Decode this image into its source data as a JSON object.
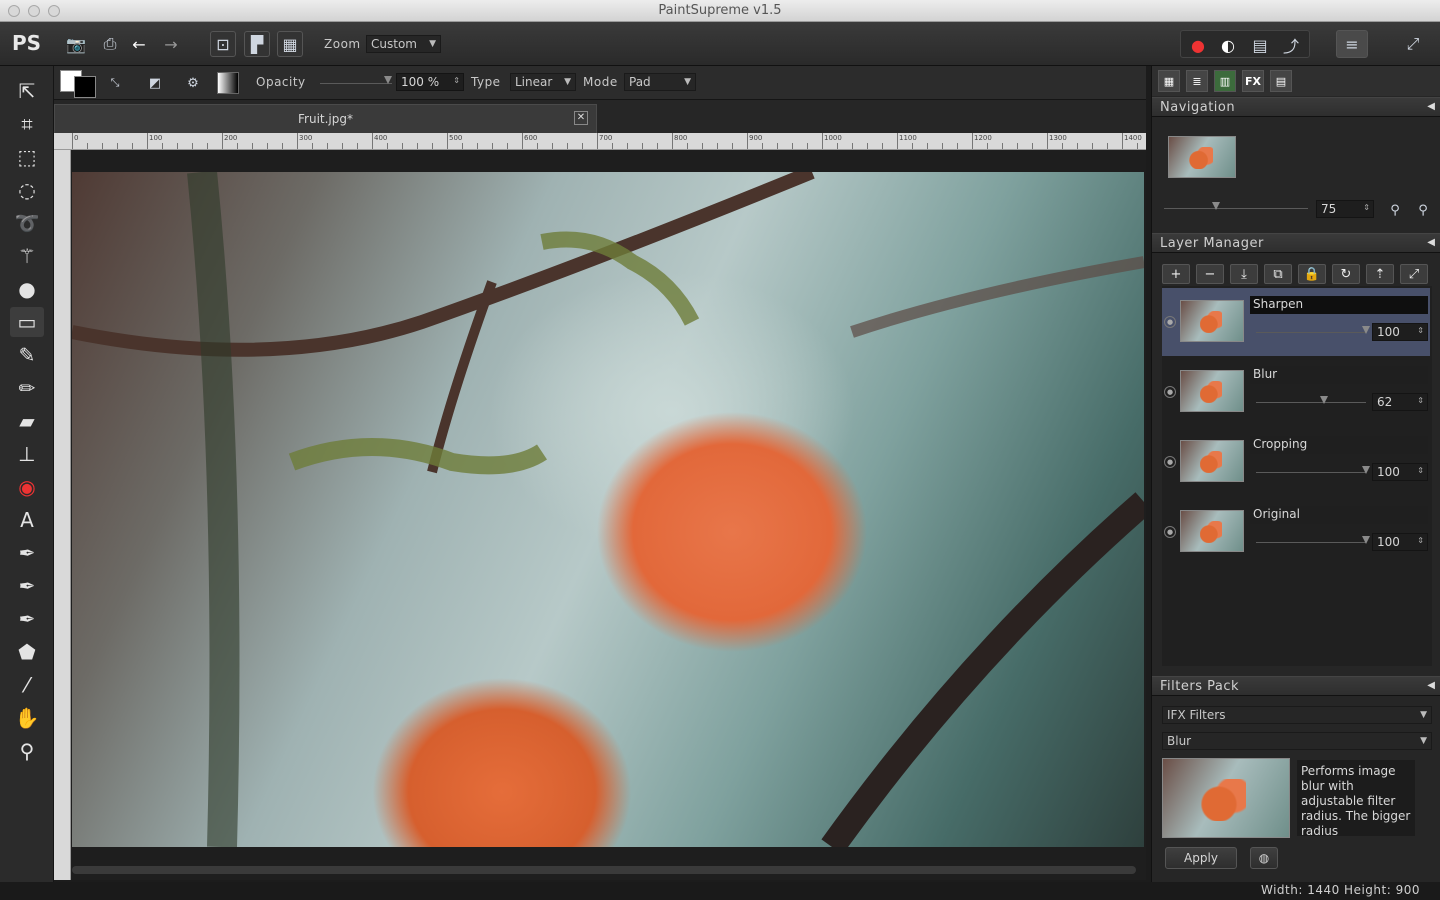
{
  "window": {
    "title": "PaintSupreme v1.5"
  },
  "toolbar": {
    "logo": "PS",
    "zoom_label": "Zoom",
    "zoom_value": "Custom",
    "icons": [
      "open-icon",
      "save-icon",
      "undo-icon",
      "redo-icon",
      "fit-icon",
      "frame-icon",
      "grid-icon"
    ],
    "right_icons": [
      "color-wheel-icon",
      "contrast-icon",
      "levels-icon",
      "curves-icon",
      "layers-icon",
      "fullscreen-icon"
    ]
  },
  "options": {
    "opacity_label": "Opacity",
    "opacity_value": "100 %",
    "type_label": "Type",
    "type_value": "Linear",
    "mode_label": "Mode",
    "mode_value": "Pad"
  },
  "tools": [
    "select-icon",
    "crop-icon",
    "rect-select-icon",
    "ellipse-select-icon",
    "lasso-icon",
    "magic-wand-icon",
    "blur-icon",
    "gradient-icon",
    "brush-icon",
    "pencil-icon",
    "eraser-icon",
    "stamp-icon",
    "red-eye-icon",
    "text-icon",
    "pen-icon",
    "pen-add-icon",
    "pen-remove-icon",
    "shape-icon",
    "eyedropper-icon",
    "hand-icon",
    "zoom-icon"
  ],
  "document": {
    "tab_name": "Fruit.jpg*"
  },
  "ruler": {
    "labels": [
      "0",
      "100",
      "200",
      "300",
      "400",
      "500",
      "600",
      "700",
      "800",
      "900",
      "1000",
      "1100",
      "1200",
      "1300",
      "1400"
    ]
  },
  "navigation": {
    "title": "Navigation",
    "zoom_value": "75"
  },
  "layer_manager": {
    "title": "Layer Manager",
    "layers": [
      {
        "name": "Sharpen",
        "opacity": "100",
        "selected": true
      },
      {
        "name": "Blur",
        "opacity": "62",
        "selected": false
      },
      {
        "name": "Cropping",
        "opacity": "100",
        "selected": false
      },
      {
        "name": "Original",
        "opacity": "100",
        "selected": false
      }
    ]
  },
  "filters": {
    "title": "Filters Pack",
    "category": "IFX Filters",
    "filter": "Blur",
    "description": "Performs image blur with adjustable filter radius. The bigger radius",
    "apply_label": "Apply"
  },
  "status": {
    "text": "Width: 1440 Height: 900"
  }
}
